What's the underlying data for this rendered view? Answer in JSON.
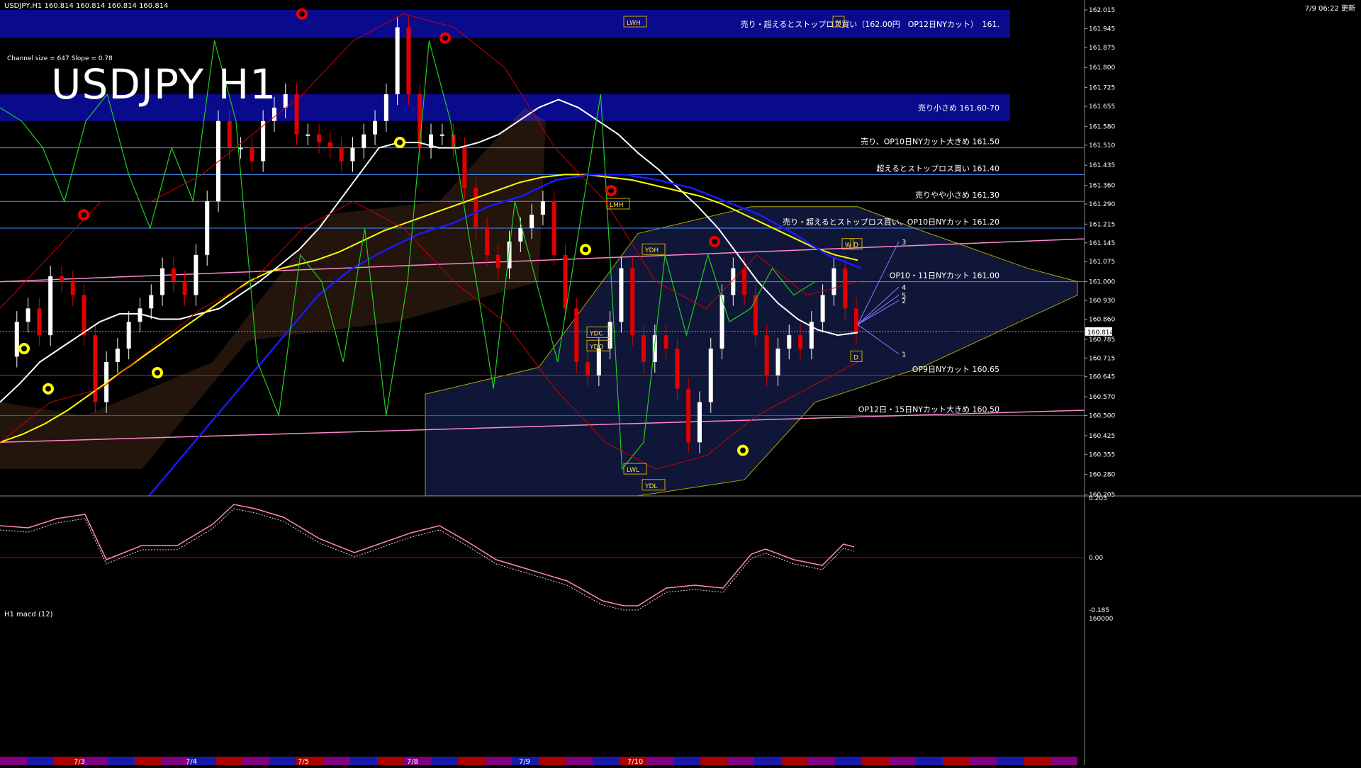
{
  "header": {
    "symbol_line": "USDJPY,H1  160.814 160.814 160.814 160.814",
    "time_line": "7/9 06:22 更新",
    "channel_info": "Channel size = 647 Slope = 0.78",
    "title": "USDJPY H1"
  },
  "macd_panel": {
    "label": "H1  macd (12)",
    "axis_labels": [
      "0.203",
      "0.00",
      "-0.185",
      "160000"
    ]
  },
  "colors": {
    "background": "#000000",
    "band_blue": "#0a0a8c",
    "up_candle": "#ffffff",
    "down_candle": "#e00000",
    "ma_white": "#ffffff",
    "ma_yellow": "#ffff00",
    "ma_blue": "#1a1aff",
    "pink_line": "#ff88cc",
    "green_line": "#22cc22",
    "red_band": "#cc0000",
    "cloud": "#3344aa"
  },
  "chart_data": {
    "type": "line",
    "symbol": "USDJPY",
    "timeframe": "H1",
    "price_axis_ticks": [
      "162.015",
      "161.945",
      "161.875",
      "161.800",
      "161.725",
      "161.655",
      "161.580",
      "161.510",
      "161.435",
      "161.360",
      "161.290",
      "161.215",
      "161.145",
      "161.075",
      "161.000",
      "160.930",
      "160.860",
      "160.785",
      "160.715",
      "160.645",
      "160.570",
      "160.500",
      "160.425",
      "160.355",
      "160.280",
      "160.205"
    ],
    "current_price": "160.814",
    "ylim": [
      160.205,
      162.015
    ],
    "date_labels": [
      "7/3",
      "7/4",
      "7/5",
      "7/8",
      "7/9",
      "7/10"
    ],
    "zones": [
      {
        "label": "売り・超えるとストップロス買い（162.00円　OP12日NYカット）　161.",
        "from": 161.91,
        "to": 162.015
      },
      {
        "label": "売り小さめ 161.60-70",
        "from": 161.6,
        "to": 161.7
      }
    ],
    "levels": [
      {
        "label": "売り、OP10日NYカット大きめ 161.50",
        "price": 161.5,
        "color": "#4a90ff"
      },
      {
        "label": "超えるとストップロス買い 161.40",
        "price": 161.4,
        "color": "#4a90ff"
      },
      {
        "label": "売りやや小さめ 161.30",
        "price": 161.3,
        "color": "#4a90ff"
      },
      {
        "label": "売り・超えるとストップロス買い、OP10日NYカット 161.20",
        "price": 161.2,
        "color": "#4a90ff"
      },
      {
        "label": "OP10・11日NYカット 161.00",
        "price": 161.0,
        "color": "#4a90ff"
      },
      {
        "label": "OP9日NYカット 160.65",
        "price": 160.65,
        "color": "#cc2222"
      },
      {
        "label": "OP12日・15日NYカット大きめ 160.50",
        "price": 160.5,
        "color": "#cc2222"
      }
    ],
    "markers": [
      "LWH",
      "LWL",
      "YDH",
      "YDL",
      "LMH",
      "YDC",
      "YDO",
      "W",
      "D",
      "M",
      "1",
      "2",
      "3",
      "4",
      "5"
    ],
    "series": [
      {
        "values": [
          160.72,
          160.85,
          160.9,
          160.8,
          161.02,
          161.0,
          160.95,
          160.8,
          160.55,
          160.7,
          160.75,
          160.85,
          160.9,
          160.95,
          161.05,
          161.0,
          160.95,
          161.1,
          161.3,
          161.6,
          161.5,
          161.5,
          161.45,
          161.6,
          161.65,
          161.7,
          161.55,
          161.55,
          161.52,
          161.5,
          161.45,
          161.5,
          161.55,
          161.6,
          161.7,
          161.95,
          161.7,
          161.5,
          161.55,
          161.55,
          161.5,
          161.35,
          161.2,
          161.1,
          161.05,
          161.15,
          161.2,
          161.25,
          161.3,
          161.1,
          160.9,
          160.7,
          160.65,
          160.75,
          160.85,
          161.05,
          160.8,
          160.7,
          160.8,
          160.75,
          160.6,
          160.4,
          160.55,
          160.75,
          160.95,
          161.05,
          160.95,
          160.8,
          160.65,
          160.75,
          160.8,
          160.75,
          160.85,
          160.95,
          161.05,
          160.9,
          160.81
        ]
      },
      {
        "values": [
          160.55,
          160.62,
          160.7,
          160.75,
          160.8,
          160.85,
          160.88,
          160.88,
          160.86,
          160.86,
          160.88,
          160.9,
          160.95,
          161.0,
          161.06,
          161.12,
          161.2,
          161.3,
          161.4,
          161.5,
          161.52,
          161.52,
          161.5,
          161.5,
          161.52,
          161.55,
          161.6,
          161.65,
          161.68,
          161.65,
          161.6,
          161.55,
          161.48,
          161.42,
          161.35,
          161.28,
          161.2,
          161.1,
          161.0,
          160.92,
          160.86,
          160.82,
          160.8,
          160.81
        ]
      },
      {
        "values": [
          160.4,
          160.43,
          160.47,
          160.52,
          160.58,
          160.64,
          160.7,
          160.76,
          160.82,
          160.88,
          160.94,
          161.0,
          161.04,
          161.06,
          161.08,
          161.11,
          161.15,
          161.19,
          161.22,
          161.25,
          161.28,
          161.31,
          161.34,
          161.37,
          161.39,
          161.4,
          161.4,
          161.39,
          161.38,
          161.36,
          161.34,
          161.32,
          161.29,
          161.25,
          161.21,
          161.17,
          161.13,
          161.1,
          161.08
        ]
      }
    ]
  }
}
